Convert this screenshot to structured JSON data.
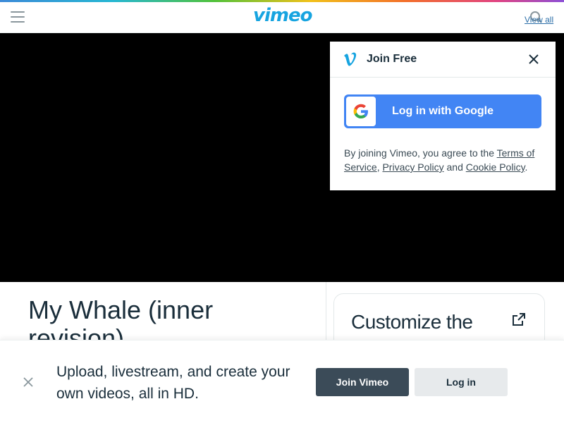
{
  "header": {
    "logo_text": "vimeo",
    "view_all_label": "View all",
    "icons": {
      "menu": "hamburger-menu-icon",
      "search": "search-icon"
    }
  },
  "colors": {
    "brand": "#17a4e0",
    "google_button": "#4285f4",
    "join_button": "#3b4b58",
    "login_button": "#e7eaec",
    "player_bg": "#000000"
  },
  "popup": {
    "title": "Join Free",
    "google_button_label": "Log in with Google",
    "terms": {
      "prefix": "By joining Vimeo, you agree to the ",
      "terms_link": "Terms of Service",
      "sep": ", ",
      "privacy_link": "Privacy Policy",
      "and": " and ",
      "cookie_link": "Cookie Policy",
      "suffix": "."
    }
  },
  "video": {
    "title": "My Whale (inner revision)"
  },
  "side_card": {
    "title": "Customize the"
  },
  "banner": {
    "text": "Upload, livestream, and create your own videos, all in HD.",
    "join_label": "Join Vimeo",
    "login_label": "Log in"
  }
}
